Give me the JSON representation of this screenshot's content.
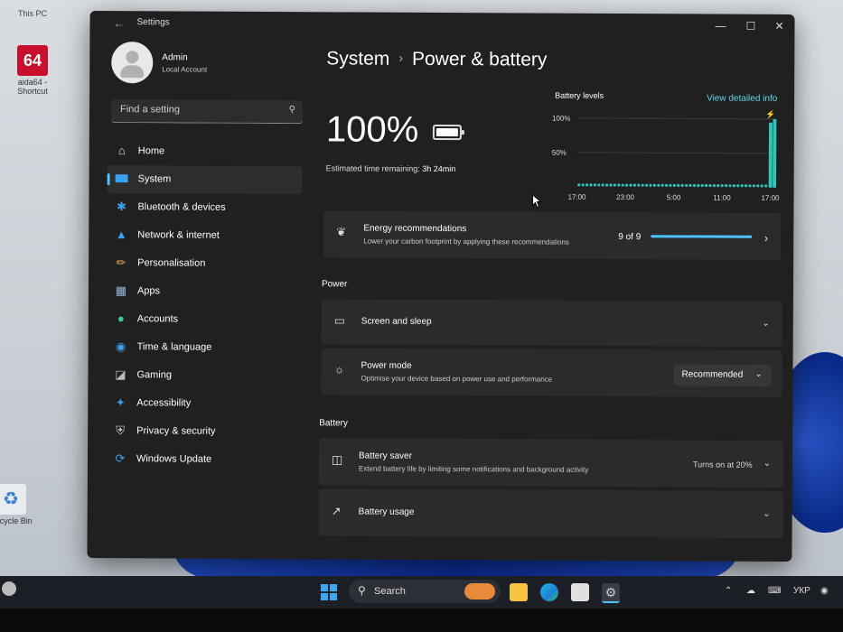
{
  "desktop": {
    "icons": [
      {
        "label": "This PC"
      },
      {
        "label": "aida64 - Shortcut"
      },
      {
        "label": "Recycle Bin"
      }
    ]
  },
  "window": {
    "title": "Settings",
    "controls": {
      "minimize": "—",
      "maximize": "☐",
      "close": "✕"
    }
  },
  "user": {
    "name": "Admin",
    "type": "Local Account"
  },
  "search": {
    "placeholder": "Find a setting"
  },
  "nav": {
    "items": [
      {
        "label": "Home",
        "icon": "home-icon",
        "active": false
      },
      {
        "label": "System",
        "icon": "system-icon",
        "active": true
      },
      {
        "label": "Bluetooth & devices",
        "icon": "bluetooth-icon",
        "active": false
      },
      {
        "label": "Network & internet",
        "icon": "network-icon",
        "active": false
      },
      {
        "label": "Personalisation",
        "icon": "brush-icon",
        "active": false
      },
      {
        "label": "Apps",
        "icon": "apps-icon",
        "active": false
      },
      {
        "label": "Accounts",
        "icon": "accounts-icon",
        "active": false
      },
      {
        "label": "Time & language",
        "icon": "globe-icon",
        "active": false
      },
      {
        "label": "Gaming",
        "icon": "gamepad-icon",
        "active": false
      },
      {
        "label": "Accessibility",
        "icon": "accessibility-icon",
        "active": false
      },
      {
        "label": "Privacy & security",
        "icon": "shield-icon",
        "active": false
      },
      {
        "label": "Windows Update",
        "icon": "update-icon",
        "active": false
      }
    ]
  },
  "breadcrumb": {
    "parent": "System",
    "current": "Power & battery"
  },
  "battery": {
    "percent": "100%",
    "remaining_label": "Estimated time remaining:",
    "remaining_value": "3h 24min"
  },
  "battery_levels": {
    "title": "Battery levels",
    "link": "View detailed info"
  },
  "chart_data": {
    "type": "bar",
    "title": "Battery levels",
    "y_ticks": [
      "100%",
      "50%"
    ],
    "ylim": [
      0,
      100
    ],
    "x_ticks": [
      "17:00",
      "23:00",
      "5:00",
      "11:00",
      "17:00"
    ],
    "grid": true,
    "values": [
      3,
      3,
      3,
      3,
      3,
      3,
      3,
      3,
      3,
      3,
      3,
      3,
      3,
      3,
      3,
      3,
      3,
      3,
      3,
      3,
      3,
      3,
      3,
      3,
      3,
      3,
      3,
      3,
      3,
      3,
      3,
      3,
      3,
      3,
      3,
      3,
      3,
      3,
      3,
      3,
      3,
      3,
      3,
      3,
      3,
      3,
      3,
      3,
      95,
      100
    ],
    "color": "#2ec4b6",
    "charging_marker": true
  },
  "energy": {
    "title": "Energy recommendations",
    "subtitle": "Lower your carbon footprint by applying these recommendations",
    "count": "9 of 9",
    "progress": 1.0
  },
  "power": {
    "section_label": "Power",
    "screen_sleep": {
      "title": "Screen and sleep"
    },
    "power_mode": {
      "title": "Power mode",
      "subtitle": "Optimise your device based on power use and performance",
      "value": "Recommended"
    }
  },
  "battery_section": {
    "section_label": "Battery",
    "saver": {
      "title": "Battery saver",
      "subtitle": "Extend battery life by limiting some notifications and background activity",
      "status": "Turns on at 20%"
    },
    "usage": {
      "title": "Battery usage"
    }
  },
  "taskbar": {
    "search_label": "Search",
    "language": "УКР"
  },
  "colors": {
    "accent": "#4cc2ff",
    "chart": "#2ec4b6",
    "link": "#63d4e0"
  }
}
